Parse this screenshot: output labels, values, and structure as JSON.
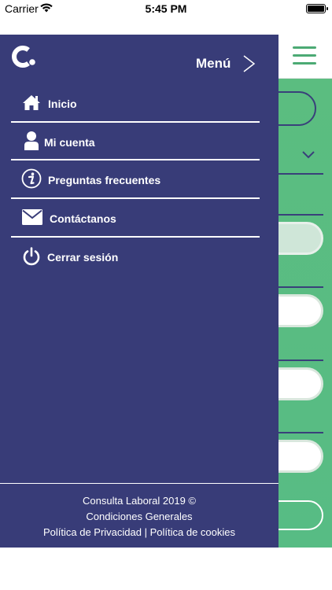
{
  "status_bar": {
    "carrier": "Carrier",
    "time": "5:45 PM"
  },
  "colors": {
    "drawer_bg": "#383c78",
    "accent_green": "#57bc84",
    "text_on_drawer": "#ffffff"
  },
  "drawer": {
    "title": "Menú",
    "items": [
      {
        "label": "Inicio",
        "icon": "home-icon"
      },
      {
        "label": "Mi cuenta",
        "icon": "user-icon"
      },
      {
        "label": "Preguntas frecuentes",
        "icon": "info-icon"
      },
      {
        "label": "Contáctanos",
        "icon": "mail-icon"
      },
      {
        "label": "Cerrar sesión",
        "icon": "power-icon"
      }
    ],
    "footer": {
      "copyright": "Consulta Laboral 2019 ©",
      "terms": "Condiciones Generales",
      "privacy": "Política de Privacidad",
      "separator": " | ",
      "cookies": "Política de cookies"
    }
  }
}
